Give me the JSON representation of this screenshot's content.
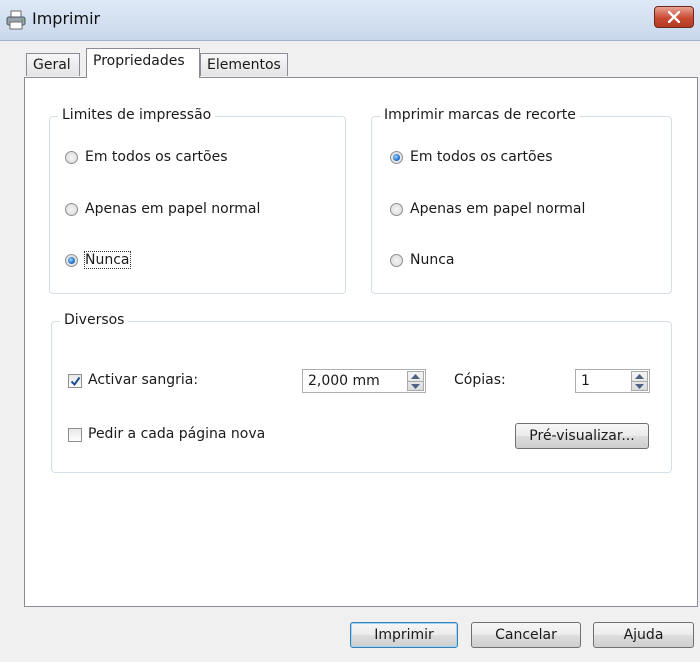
{
  "window": {
    "title": "Imprimir",
    "icon": "printer-icon",
    "close_icon": "close-icon"
  },
  "tabs": [
    {
      "label": "Geral",
      "active": false
    },
    {
      "label": "Propriedades",
      "active": true
    },
    {
      "label": "Elementos",
      "active": false
    }
  ],
  "print_limits": {
    "legend": "Limites de impressão",
    "options": [
      {
        "label": "Em todos os cartões",
        "checked": false
      },
      {
        "label": "Apenas em papel normal",
        "checked": false
      },
      {
        "label": "Nunca",
        "checked": true
      }
    ]
  },
  "crop_marks": {
    "legend": "Imprimir marcas de recorte",
    "options": [
      {
        "label": "Em todos os cartões",
        "checked": true
      },
      {
        "label": "Apenas em papel normal",
        "checked": false
      },
      {
        "label": "Nunca",
        "checked": false
      }
    ]
  },
  "misc": {
    "legend": "Diversos",
    "bleed": {
      "label": "Activar sangria:",
      "checked": true,
      "value": "2,000 mm"
    },
    "copies": {
      "label": "Cópias:",
      "value": "1"
    },
    "ask_each_page": {
      "label": "Pedir a cada página nova",
      "checked": false
    },
    "preview_label": "Pré-visualizar..."
  },
  "footer": {
    "print_label": "Imprimir",
    "cancel_label": "Cancelar",
    "help_label": "Ajuda"
  }
}
